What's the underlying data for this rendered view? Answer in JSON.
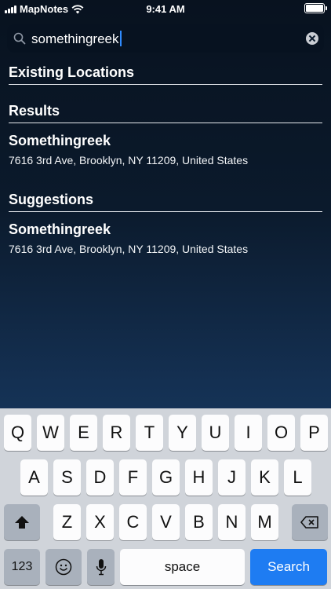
{
  "status_bar": {
    "carrier": "MapNotes",
    "time": "9:41 AM"
  },
  "search": {
    "value": "somethingreek"
  },
  "existing": {
    "heading": "Existing Locations"
  },
  "results": {
    "heading": "Results",
    "items": [
      {
        "name": "Somethingreek",
        "address": "7616 3rd Ave, Brooklyn, NY  11209, United States"
      }
    ]
  },
  "suggestions": {
    "heading": "Suggestions",
    "items": [
      {
        "name": "Somethingreek",
        "address": "7616 3rd Ave, Brooklyn, NY  11209, United States"
      }
    ]
  },
  "keyboard": {
    "row1": [
      "Q",
      "W",
      "E",
      "R",
      "T",
      "Y",
      "U",
      "I",
      "O",
      "P"
    ],
    "row2": [
      "A",
      "S",
      "D",
      "F",
      "G",
      "H",
      "J",
      "K",
      "L"
    ],
    "row3": [
      "Z",
      "X",
      "C",
      "V",
      "B",
      "N",
      "M"
    ],
    "numbers_label": "123",
    "space_label": "space",
    "search_label": "Search"
  },
  "colors": {
    "accent": "#1e7cf2",
    "background_top": "#08121f",
    "background_bottom": "#1d4470"
  }
}
